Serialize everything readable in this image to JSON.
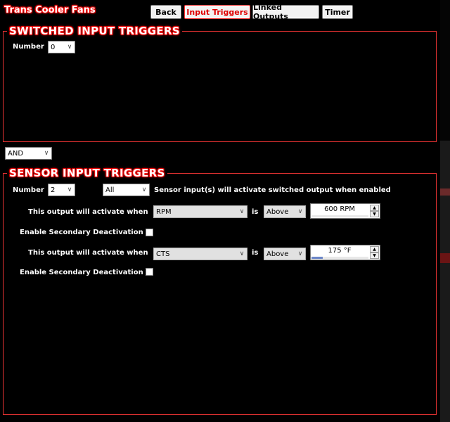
{
  "app": {
    "title": "Trans Cooler Fans"
  },
  "nav": {
    "back": "Back",
    "input_triggers": "Input Triggers",
    "linked_outputs": "Linked Outputs",
    "timer": "Timer"
  },
  "switched": {
    "title": "SWITCHED INPUT TRIGGERS",
    "number_label": "Number",
    "number_value": "0"
  },
  "logic": {
    "value": "AND"
  },
  "sensor": {
    "title": "SENSOR INPUT TRIGGERS",
    "number_label": "Number",
    "number_value": "2",
    "mode_value": "All",
    "description": "Sensor input(s) will activate switched output when enabled",
    "rows": [
      {
        "activate_label": "This output will activate when",
        "sensor": "RPM",
        "is_label": "is",
        "comparison": "Above",
        "threshold": "600 RPM",
        "level": 0.0,
        "secondary_label": "Enable Secondary Deactivation",
        "secondary_checked": false
      },
      {
        "activate_label": "This output will activate when",
        "sensor": "CTS",
        "is_label": "is",
        "comparison": "Above",
        "threshold": "175 °F",
        "level": 0.2,
        "secondary_label": "Enable Secondary Deactivation",
        "secondary_checked": false
      }
    ]
  },
  "icons": {
    "dropdown": "chevron-down-icon",
    "spin_up": "arrow-up-icon",
    "spin_down": "arrow-down-icon"
  },
  "colors": {
    "accent": "#e63232",
    "active_text": "#e00000",
    "background": "#000000"
  }
}
